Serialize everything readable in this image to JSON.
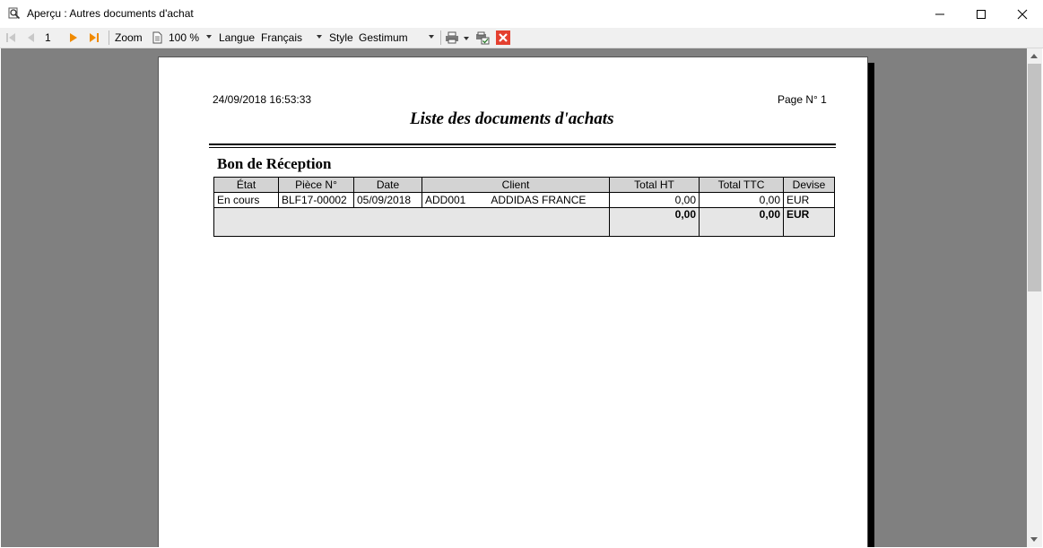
{
  "window": {
    "title": "Aperçu : Autres documents d'achat"
  },
  "toolbar": {
    "page_value": "1",
    "zoom_label": "Zoom",
    "zoom_value": "100 %",
    "langue_label": "Langue",
    "langue_value": "Français",
    "style_label": "Style",
    "style_value": "Gestimum"
  },
  "report": {
    "datetime": "24/09/2018 16:53:33",
    "page_label": "Page N° 1",
    "title": "Liste des documents d'achats",
    "section_title": "Bon de Réception",
    "columns": [
      "État",
      "Pièce N°",
      "Date",
      "Client",
      "Total HT",
      "Total TTC",
      "Devise"
    ],
    "rows": [
      {
        "etat": "En cours",
        "piece": "BLF17-00002",
        "date": "05/09/2018",
        "client_code": "ADD001",
        "client_name": "ADDIDAS FRANCE",
        "total_ht": "0,00",
        "total_ttc": "0,00",
        "devise": "EUR"
      }
    ],
    "totals": {
      "total_ht": "0,00",
      "total_ttc": "0,00",
      "devise": "EUR"
    }
  }
}
